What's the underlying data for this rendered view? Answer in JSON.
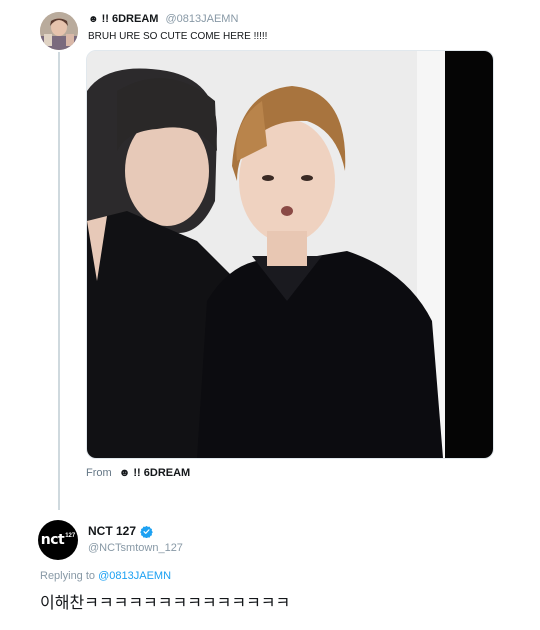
{
  "thread": {
    "original_tweet": {
      "display_name_emoji": "☻",
      "display_name": "!! 6DREAM",
      "handle": "@0813JAEMN",
      "text": "BRUH URE SO CUTE COME HERE !!!!!",
      "from_label": "From",
      "from_emoji": "☻",
      "from_name": "!! 6DREAM"
    },
    "reply_tweet": {
      "avatar_logo": "nct",
      "avatar_number": "127",
      "display_name": "NCT 127",
      "verified": true,
      "handle": "@NCTsmtown_127",
      "replying_label": "Replying to",
      "replying_to": "@0813JAEMN",
      "text": "이해찬ㅋㅋㅋㅋㅋㅋㅋㅋㅋㅋㅋㅋㅋㅋ"
    }
  },
  "icons": {
    "verified": "verified-badge-icon",
    "emoji": "smiley-icon"
  },
  "colors": {
    "handle_gray": "#8899a6",
    "link_blue": "#1da1f2",
    "verified_blue": "#1da1f2",
    "thread_line": "#cfd9de"
  }
}
